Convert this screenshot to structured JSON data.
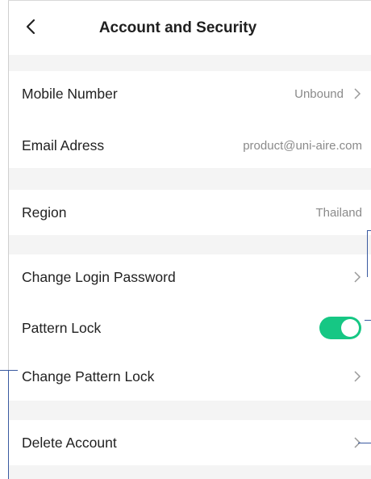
{
  "header": {
    "title": "Account and Security",
    "back_icon": "chevron-left-icon"
  },
  "contact": {
    "mobile": {
      "label": "Mobile Number",
      "value": "Unbound"
    },
    "email": {
      "label": "Email Adress",
      "value": "product@uni-aire.com"
    }
  },
  "locale": {
    "region": {
      "label": "Region",
      "value": "Thailand"
    }
  },
  "security": {
    "change_password": {
      "label": "Change Login Password"
    },
    "pattern_lock": {
      "label": "Pattern Lock",
      "enabled": true
    },
    "change_pattern": {
      "label": "Change Pattern Lock"
    }
  },
  "danger": {
    "delete_account": {
      "label": "Delete Account"
    }
  },
  "colors": {
    "toggle_on": "#16c784",
    "section_gap": "#f4f4f4",
    "annotation_line": "#3a5aa0"
  }
}
